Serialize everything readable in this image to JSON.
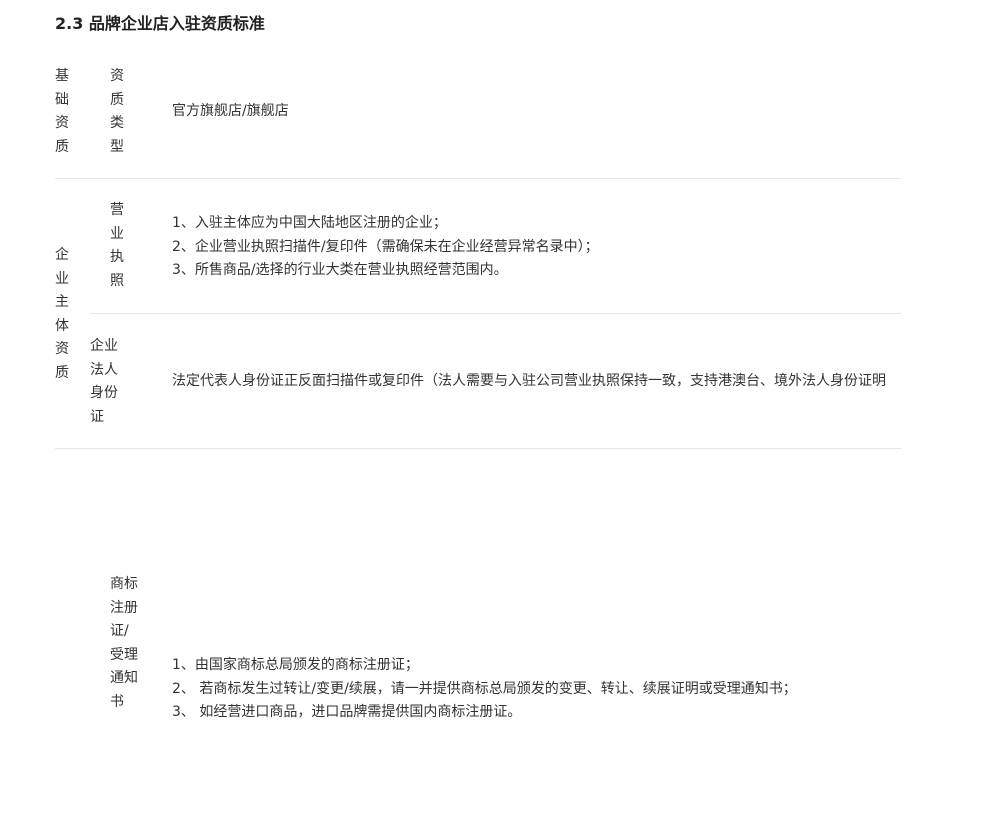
{
  "heading": "2.3 品牌企业店入驻资质标准",
  "rows": {
    "basic": {
      "category": "基础资质",
      "item": "资质类型",
      "content": "官方旗舰店/旗舰店"
    },
    "enterprise": {
      "category": "企业主体资质",
      "license": {
        "item": "营业执照",
        "lines": [
          "1、入驻主体应为中国大陆地区注册的企业；",
          "2、企业营业执照扫描件/复印件（需确保未在企业经营异常名录中）；",
          "3、所售商品/选择的行业大类在营业执照经营范围内。"
        ]
      },
      "legal_id": {
        "item": "企业法人身份证",
        "content": "法定代表人身份证正反面扫描件或复印件（法人需要与入驻公司营业执照保持一致，支持港澳台、境外法人身份证明"
      }
    },
    "trademark": {
      "item": "商标注册证/受理通知书",
      "lines": [
        "1、由国家商标总局颁发的商标注册证；",
        "2、 若商标发生过转让/变更/续展，请一并提供商标总局颁发的变更、转让、续展证明或受理通知书；",
        "3、 如经营进口商品，进口品牌需提供国内商标注册证。"
      ]
    }
  }
}
